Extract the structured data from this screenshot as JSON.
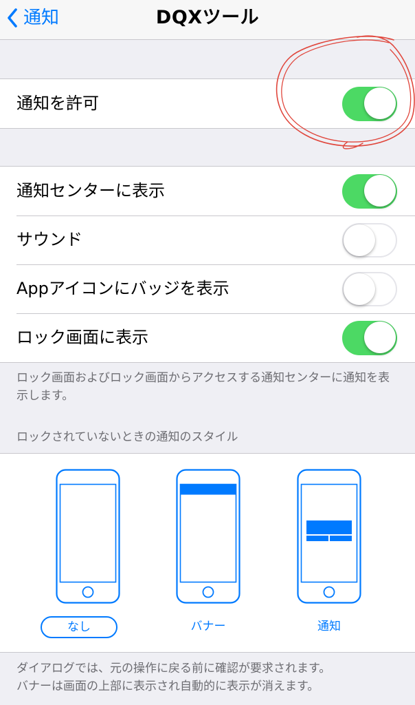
{
  "nav": {
    "back_label": "通知",
    "title": "DQXツール"
  },
  "allow_group": {
    "rows": [
      {
        "label": "通知を許可",
        "on": true
      }
    ]
  },
  "settings_group": {
    "rows": [
      {
        "label": "通知センターに表示",
        "on": true
      },
      {
        "label": "サウンド",
        "on": false
      },
      {
        "label": "Appアイコンにバッジを表示",
        "on": false
      },
      {
        "label": "ロック画面に表示",
        "on": true
      }
    ]
  },
  "lock_screen_footer": "ロック画面およびロック画面からアクセスする通知センターに通知を表示します。",
  "style_section": {
    "header": "ロックされていないときの通知のスタイル",
    "options": [
      {
        "label": "なし",
        "selected": true
      },
      {
        "label": "バナー",
        "selected": false
      },
      {
        "label": "通知",
        "selected": false
      }
    ]
  },
  "style_footer": {
    "line1": "ダイアログでは、元の操作に戻る前に確認が要求されます。",
    "line2": "バナーは画面の上部に表示され自動的に表示が消えます。"
  },
  "colors": {
    "accent": "#007aff",
    "switch_on": "#4cd964",
    "annotation": "#e0463c",
    "background": "#efeff4"
  }
}
